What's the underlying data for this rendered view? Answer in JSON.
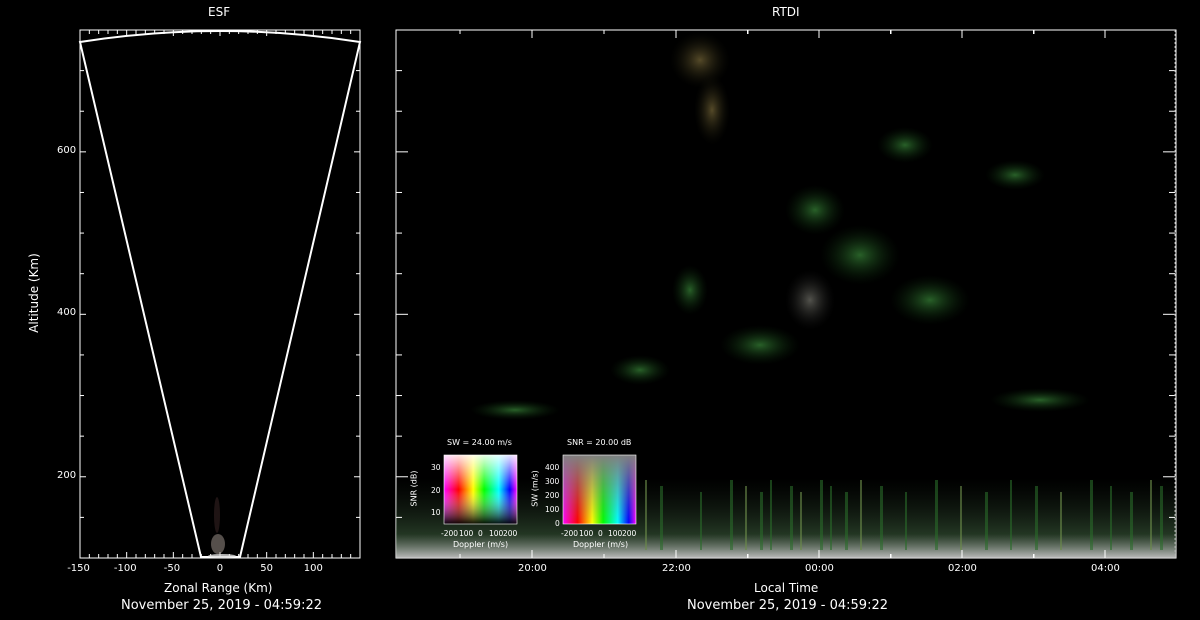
{
  "esf": {
    "title": "ESF",
    "xlabel": "Zonal Range (Km)",
    "ylabel": "Altitude (Km)",
    "date": "November 25, 2019 - 04:59:22",
    "x_ticks": [
      "-150",
      "-100",
      "-50",
      "0",
      "50",
      "100"
    ],
    "y_ticks": [
      "200",
      "400",
      "600"
    ]
  },
  "rtdi": {
    "title": "RTDI",
    "xlabel": "Local Time",
    "date": "November 25, 2019 - 04:59:22",
    "x_ticks": [
      "20:00",
      "22:00",
      "00:00",
      "02:00",
      "04:00"
    ]
  },
  "legend_sw": {
    "title": "SW = 24.00 m/s",
    "ylabel": "SNR (dB)",
    "xlabel": "Doppler (m/s)",
    "y_ticks": [
      "30",
      "20",
      "10"
    ],
    "x_ticks": [
      "-200",
      "100",
      "0",
      "100",
      "200"
    ]
  },
  "legend_snr": {
    "title": "SNR = 20.00 dB",
    "ylabel": "SW (m/s)",
    "xlabel": "Doppler (m/s)",
    "y_ticks": [
      "400",
      "300",
      "200",
      "100",
      "0"
    ],
    "x_ticks": [
      "-200",
      "100",
      "0",
      "100",
      "200"
    ]
  },
  "chart_data": [
    {
      "type": "scatter",
      "title": "ESF",
      "xlabel": "Zonal Range (Km)",
      "ylabel": "Altitude (Km)",
      "xlim": [
        -150,
        150
      ],
      "ylim": [
        100,
        750
      ],
      "beam_sector_edges": [
        {
          "x": [
            -20,
            -150
          ],
          "y": [
            100,
            740
          ]
        },
        {
          "x": [
            20,
            150
          ],
          "y": [
            100,
            740
          ]
        }
      ]
    },
    {
      "type": "heatmap",
      "title": "RTDI",
      "xlabel": "Local Time",
      "x_ticks": [
        "20:00",
        "22:00",
        "00:00",
        "02:00",
        "04:00"
      ],
      "ylim": [
        100,
        750
      ]
    }
  ]
}
